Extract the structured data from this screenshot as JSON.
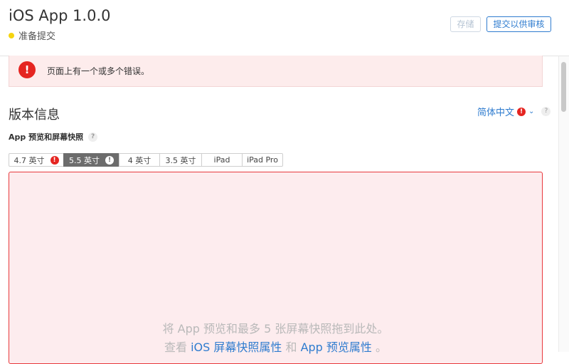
{
  "header": {
    "app_title": "iOS App 1.0.0",
    "status": "准备提交",
    "save_label": "存储",
    "submit_label": "提交以供审核"
  },
  "error_banner": {
    "icon": "!",
    "message": "页面上有一个或多个错误。"
  },
  "section": {
    "title": "版本信息",
    "language": "简体中文",
    "help_icon": "?"
  },
  "screenshots": {
    "label": "App 预览和屏幕快照",
    "tabs": [
      {
        "label": "4.7 英寸",
        "badge": "!"
      },
      {
        "label": "5.5 英寸",
        "badge": "!"
      },
      {
        "label": "4 英寸"
      },
      {
        "label": "3.5 英寸"
      },
      {
        "label": "iPad"
      },
      {
        "label": "iPad Pro"
      }
    ],
    "drop_text": "将 App 预览和最多 5 张屏幕快照拖到此处。",
    "drop_prefix": "查看",
    "link1": "iOS 屏幕快照属性",
    "drop_conj": "和",
    "link2": "App 预览属性",
    "drop_suffix": "。"
  },
  "colors": {
    "accent": "#2f7ccf",
    "error": "#e52521",
    "status_dot": "#f5d40f",
    "dropzone_bg": "#fdecee"
  },
  "icons": [
    "error-icon",
    "chevron-down-icon",
    "help-icon",
    "warning-icon"
  ]
}
